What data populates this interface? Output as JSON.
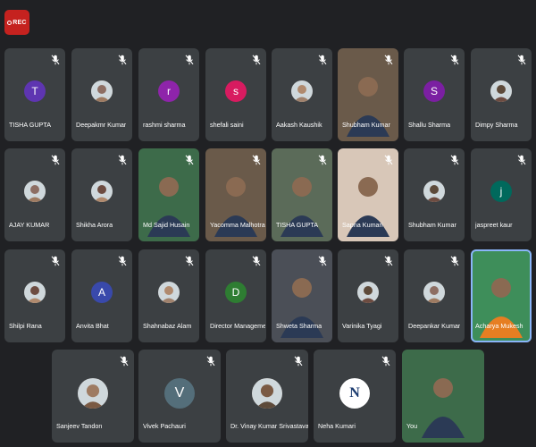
{
  "recording": {
    "label": "REC"
  },
  "colors": {
    "background": "#202124",
    "tile": "#3c4043",
    "record": "#c5221f",
    "active_border": "#8ab4f8"
  },
  "participants": [
    {
      "name": "TISHA GUPTA",
      "initial": "T",
      "avatar_color": "#5e35b1",
      "kind": "letter",
      "muted": true
    },
    {
      "name": "Deepakmr Kumar",
      "kind": "photo",
      "muted": true
    },
    {
      "name": "rashmi sharma",
      "initial": "r",
      "avatar_color": "#8e24aa",
      "kind": "letter",
      "muted": true
    },
    {
      "name": "shefali saini",
      "initial": "s",
      "avatar_color": "#d81b60",
      "kind": "letter",
      "muted": true
    },
    {
      "name": "Aakash Kaushik",
      "kind": "photo",
      "muted": true
    },
    {
      "name": "Shubham Kumar",
      "kind": "video",
      "muted": true
    },
    {
      "name": "Shallu Sharma",
      "initial": "S",
      "avatar_color": "#7b1fa2",
      "kind": "letter",
      "muted": true
    },
    {
      "name": "Dimpy Sharma",
      "kind": "photo",
      "muted": true
    },
    {
      "name": "AJAY KUMAR",
      "kind": "photo",
      "muted": true
    },
    {
      "name": "Shikha Arora",
      "kind": "photo",
      "muted": true
    },
    {
      "name": "Md Sajid Husain",
      "kind": "video",
      "muted": true
    },
    {
      "name": "Yacomma Malhotra",
      "kind": "video",
      "muted": true
    },
    {
      "name": "TISHA GUPTA",
      "kind": "video",
      "muted": true
    },
    {
      "name": "Sapna Kumari",
      "kind": "video",
      "muted": true
    },
    {
      "name": "Shubham Kumar",
      "kind": "photo",
      "muted": true
    },
    {
      "name": "jaspreet kaur",
      "initial": "j",
      "avatar_color": "#00695c",
      "kind": "letter",
      "muted": true
    },
    {
      "name": "Shilpi Rana",
      "kind": "photo",
      "muted": true
    },
    {
      "name": "Anvita Bhat",
      "initial": "A",
      "avatar_color": "#3949ab",
      "kind": "letter",
      "muted": true
    },
    {
      "name": "Shahnabaz Alam",
      "kind": "photo",
      "muted": true
    },
    {
      "name": "Director Managemen...",
      "initial": "D",
      "avatar_color": "#2e7d32",
      "kind": "letter",
      "muted": true
    },
    {
      "name": "Shweta Sharma",
      "kind": "video",
      "muted": true
    },
    {
      "name": "Varinika Tyagi",
      "kind": "photo",
      "muted": true
    },
    {
      "name": "Deepankar Kumar",
      "kind": "photo",
      "muted": true
    },
    {
      "name": "Acharya Mukesh",
      "kind": "video",
      "muted": false,
      "active": true
    },
    {
      "name": "Sanjeev Tandon",
      "kind": "photo",
      "muted": true
    },
    {
      "name": "Vivek Pachauri",
      "initial": "V",
      "avatar_color": "#546e7a",
      "kind": "letter",
      "muted": true
    },
    {
      "name": "Dr. Vinay Kumar Srivastava",
      "kind": "photo",
      "muted": true
    },
    {
      "name": "Neha Kumari",
      "initial": "N",
      "avatar_color": "#ffffff",
      "kind": "logo",
      "muted": true
    },
    {
      "name": "You",
      "kind": "self",
      "muted": false
    }
  ]
}
